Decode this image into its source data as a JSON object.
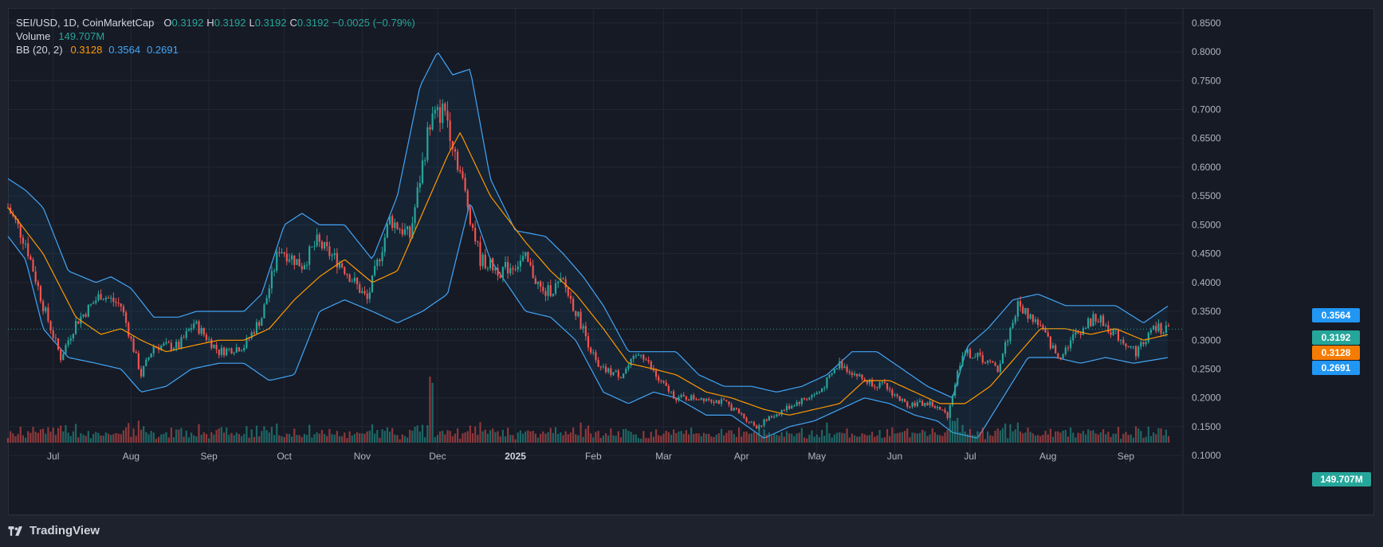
{
  "legend": {
    "symbol": "SEI/USD, 1D, CoinMarketCap",
    "o_label": "O",
    "o_value": "0.3192",
    "h_label": "H",
    "h_value": "0.3192",
    "l_label": "L",
    "l_value": "0.3192",
    "c_label": "C",
    "c_value": "0.3192",
    "change": "−0.0025 (−0.79%)",
    "volume_label": "Volume",
    "volume_value": "149.707M",
    "bb_label": "BB (20, 2)",
    "bb_basis": "0.3128",
    "bb_upper": "0.3564",
    "bb_lower": "0.2691"
  },
  "price_tags": {
    "upper": "0.3564",
    "last": "0.3192",
    "basis": "0.3128",
    "lower": "0.2691",
    "volume": "149.707M"
  },
  "brand": "TradingView",
  "colors": {
    "up": "#26a69a",
    "down": "#ef5350",
    "band": "#42a5f5",
    "basis": "#ff9800",
    "bg": "#161a25",
    "grid": "#232734",
    "text": "#b2b5be"
  },
  "chart_data": {
    "type": "candlestick",
    "title": "SEI/USD, 1D, CoinMarketCap",
    "x_ticks": [
      "Jul",
      "Aug",
      "Sep",
      "Oct",
      "Nov",
      "Dec",
      "2025",
      "Feb",
      "Mar",
      "Apr",
      "May",
      "Jun",
      "Jul",
      "Aug",
      "Sep"
    ],
    "y_ticks": [
      "0.8500",
      "0.8000",
      "0.7500",
      "0.7000",
      "0.6500",
      "0.6000",
      "0.5500",
      "0.5000",
      "0.4500",
      "0.4000",
      "0.3500",
      "0.3000",
      "0.2500",
      "0.2000",
      "0.1500",
      "0.1000"
    ],
    "ylim": [
      0.085,
      0.876
    ],
    "grid": true,
    "close_path": [
      [
        "2024-06-13",
        0.53
      ],
      [
        "2024-06-20",
        0.47
      ],
      [
        "2024-06-27",
        0.36
      ],
      [
        "2024-07-04",
        0.27
      ],
      [
        "2024-07-10",
        0.33
      ],
      [
        "2024-07-20",
        0.38
      ],
      [
        "2024-07-28",
        0.36
      ],
      [
        "2024-08-05",
        0.24
      ],
      [
        "2024-08-10",
        0.29
      ],
      [
        "2024-08-20",
        0.29
      ],
      [
        "2024-08-26",
        0.33
      ],
      [
        "2024-09-05",
        0.28
      ],
      [
        "2024-09-15",
        0.29
      ],
      [
        "2024-09-22",
        0.34
      ],
      [
        "2024-09-29",
        0.46
      ],
      [
        "2024-10-08",
        0.43
      ],
      [
        "2024-10-14",
        0.47
      ],
      [
        "2024-10-24",
        0.43
      ],
      [
        "2024-11-03",
        0.37
      ],
      [
        "2024-11-12",
        0.51
      ],
      [
        "2024-11-20",
        0.48
      ],
      [
        "2024-11-28",
        0.68
      ],
      [
        "2024-12-04",
        0.7
      ],
      [
        "2024-12-09",
        0.61
      ],
      [
        "2024-12-18",
        0.44
      ],
      [
        "2024-12-26",
        0.42
      ],
      [
        "2025-01-05",
        0.44
      ],
      [
        "2025-01-12",
        0.38
      ],
      [
        "2025-01-20",
        0.4
      ],
      [
        "2025-01-27",
        0.33
      ],
      [
        "2025-02-03",
        0.25
      ],
      [
        "2025-02-12",
        0.24
      ],
      [
        "2025-02-20",
        0.28
      ],
      [
        "2025-02-27",
        0.23
      ],
      [
        "2025-03-06",
        0.2
      ],
      [
        "2025-03-18",
        0.2
      ],
      [
        "2025-03-26",
        0.19
      ],
      [
        "2025-04-07",
        0.15
      ],
      [
        "2025-04-14",
        0.17
      ],
      [
        "2025-04-22",
        0.19
      ],
      [
        "2025-05-02",
        0.21
      ],
      [
        "2025-05-10",
        0.26
      ],
      [
        "2025-05-20",
        0.23
      ],
      [
        "2025-05-28",
        0.22
      ],
      [
        "2025-06-05",
        0.19
      ],
      [
        "2025-06-15",
        0.19
      ],
      [
        "2025-06-22",
        0.17
      ],
      [
        "2025-06-28",
        0.28
      ],
      [
        "2025-07-05",
        0.27
      ],
      [
        "2025-07-12",
        0.25
      ],
      [
        "2025-07-20",
        0.36
      ],
      [
        "2025-07-28",
        0.33
      ],
      [
        "2025-08-05",
        0.27
      ],
      [
        "2025-08-12",
        0.31
      ],
      [
        "2025-08-20",
        0.34
      ],
      [
        "2025-08-28",
        0.31
      ],
      [
        "2025-09-05",
        0.28
      ],
      [
        "2025-09-12",
        0.32
      ],
      [
        "2025-09-18",
        0.32
      ]
    ],
    "bollinger": {
      "upper": [
        [
          "2024-06-13",
          0.58
        ],
        [
          "2024-06-20",
          0.56
        ],
        [
          "2024-06-27",
          0.53
        ],
        [
          "2024-07-07",
          0.42
        ],
        [
          "2024-07-18",
          0.4
        ],
        [
          "2024-07-24",
          0.41
        ],
        [
          "2024-08-01",
          0.39
        ],
        [
          "2024-08-10",
          0.34
        ],
        [
          "2024-08-20",
          0.34
        ],
        [
          "2024-08-27",
          0.35
        ],
        [
          "2024-09-05",
          0.35
        ],
        [
          "2024-09-15",
          0.35
        ],
        [
          "2024-09-22",
          0.38
        ],
        [
          "2024-10-01",
          0.5
        ],
        [
          "2024-10-08",
          0.52
        ],
        [
          "2024-10-15",
          0.5
        ],
        [
          "2024-10-25",
          0.5
        ],
        [
          "2024-11-05",
          0.44
        ],
        [
          "2024-11-15",
          0.55
        ],
        [
          "2024-11-24",
          0.74
        ],
        [
          "2024-12-01",
          0.8
        ],
        [
          "2024-12-07",
          0.76
        ],
        [
          "2024-12-14",
          0.77
        ],
        [
          "2024-12-22",
          0.58
        ],
        [
          "2025-01-01",
          0.49
        ],
        [
          "2025-01-13",
          0.48
        ],
        [
          "2025-01-20",
          0.45
        ],
        [
          "2025-01-28",
          0.41
        ],
        [
          "2025-02-05",
          0.36
        ],
        [
          "2025-02-15",
          0.28
        ],
        [
          "2025-02-25",
          0.28
        ],
        [
          "2025-03-06",
          0.28
        ],
        [
          "2025-03-15",
          0.24
        ],
        [
          "2025-03-25",
          0.22
        ],
        [
          "2025-04-05",
          0.22
        ],
        [
          "2025-04-15",
          0.21
        ],
        [
          "2025-04-25",
          0.22
        ],
        [
          "2025-05-05",
          0.24
        ],
        [
          "2025-05-15",
          0.28
        ],
        [
          "2025-05-25",
          0.28
        ],
        [
          "2025-06-04",
          0.25
        ],
        [
          "2025-06-14",
          0.22
        ],
        [
          "2025-06-24",
          0.2
        ],
        [
          "2025-06-30",
          0.29
        ],
        [
          "2025-07-08",
          0.32
        ],
        [
          "2025-07-18",
          0.37
        ],
        [
          "2025-07-28",
          0.38
        ],
        [
          "2025-08-08",
          0.36
        ],
        [
          "2025-08-18",
          0.36
        ],
        [
          "2025-08-28",
          0.36
        ],
        [
          "2025-09-08",
          0.33
        ],
        [
          "2025-09-18",
          0.36
        ]
      ],
      "lower": [
        [
          "2024-06-13",
          0.48
        ],
        [
          "2024-06-20",
          0.44
        ],
        [
          "2024-06-27",
          0.32
        ],
        [
          "2024-07-07",
          0.27
        ],
        [
          "2024-07-18",
          0.26
        ],
        [
          "2024-07-28",
          0.25
        ],
        [
          "2024-08-05",
          0.21
        ],
        [
          "2024-08-15",
          0.22
        ],
        [
          "2024-08-25",
          0.25
        ],
        [
          "2024-09-05",
          0.26
        ],
        [
          "2024-09-15",
          0.26
        ],
        [
          "2024-09-25",
          0.23
        ],
        [
          "2024-10-05",
          0.24
        ],
        [
          "2024-10-15",
          0.35
        ],
        [
          "2024-10-25",
          0.37
        ],
        [
          "2024-11-05",
          0.35
        ],
        [
          "2024-11-15",
          0.33
        ],
        [
          "2024-11-25",
          0.35
        ],
        [
          "2024-12-05",
          0.38
        ],
        [
          "2024-12-14",
          0.54
        ],
        [
          "2024-12-22",
          0.44
        ],
        [
          "2025-01-05",
          0.35
        ],
        [
          "2025-01-15",
          0.34
        ],
        [
          "2025-01-25",
          0.3
        ],
        [
          "2025-02-05",
          0.21
        ],
        [
          "2025-02-15",
          0.19
        ],
        [
          "2025-02-25",
          0.21
        ],
        [
          "2025-03-06",
          0.2
        ],
        [
          "2025-03-18",
          0.17
        ],
        [
          "2025-03-28",
          0.17
        ],
        [
          "2025-04-10",
          0.13
        ],
        [
          "2025-04-20",
          0.15
        ],
        [
          "2025-04-30",
          0.16
        ],
        [
          "2025-05-10",
          0.18
        ],
        [
          "2025-05-20",
          0.2
        ],
        [
          "2025-05-30",
          0.19
        ],
        [
          "2025-06-09",
          0.17
        ],
        [
          "2025-06-18",
          0.16
        ],
        [
          "2025-06-24",
          0.14
        ],
        [
          "2025-07-04",
          0.13
        ],
        [
          "2025-07-14",
          0.2
        ],
        [
          "2025-07-24",
          0.27
        ],
        [
          "2025-08-04",
          0.27
        ],
        [
          "2025-08-14",
          0.26
        ],
        [
          "2025-08-24",
          0.27
        ],
        [
          "2025-09-04",
          0.26
        ],
        [
          "2025-09-18",
          0.27
        ]
      ],
      "basis": [
        [
          "2024-06-13",
          0.53
        ],
        [
          "2024-06-27",
          0.45
        ],
        [
          "2024-07-10",
          0.34
        ],
        [
          "2024-07-20",
          0.31
        ],
        [
          "2024-07-28",
          0.32
        ],
        [
          "2024-08-05",
          0.3
        ],
        [
          "2024-08-15",
          0.28
        ],
        [
          "2024-08-25",
          0.29
        ],
        [
          "2024-09-05",
          0.3
        ],
        [
          "2024-09-15",
          0.3
        ],
        [
          "2024-09-25",
          0.32
        ],
        [
          "2024-10-05",
          0.37
        ],
        [
          "2024-10-15",
          0.41
        ],
        [
          "2024-10-25",
          0.44
        ],
        [
          "2024-11-05",
          0.4
        ],
        [
          "2024-11-15",
          0.42
        ],
        [
          "2024-11-25",
          0.52
        ],
        [
          "2024-12-05",
          0.62
        ],
        [
          "2024-12-10",
          0.66
        ],
        [
          "2024-12-22",
          0.55
        ],
        [
          "2025-01-05",
          0.47
        ],
        [
          "2025-01-15",
          0.42
        ],
        [
          "2025-01-25",
          0.38
        ],
        [
          "2025-02-05",
          0.32
        ],
        [
          "2025-02-15",
          0.26
        ],
        [
          "2025-02-25",
          0.25
        ],
        [
          "2025-03-06",
          0.24
        ],
        [
          "2025-03-18",
          0.21
        ],
        [
          "2025-03-28",
          0.2
        ],
        [
          "2025-04-10",
          0.18
        ],
        [
          "2025-04-20",
          0.17
        ],
        [
          "2025-04-30",
          0.18
        ],
        [
          "2025-05-10",
          0.19
        ],
        [
          "2025-05-20",
          0.23
        ],
        [
          "2025-05-30",
          0.23
        ],
        [
          "2025-06-09",
          0.21
        ],
        [
          "2025-06-19",
          0.19
        ],
        [
          "2025-06-29",
          0.19
        ],
        [
          "2025-07-09",
          0.22
        ],
        [
          "2025-07-19",
          0.27
        ],
        [
          "2025-07-29",
          0.32
        ],
        [
          "2025-08-08",
          0.32
        ],
        [
          "2025-08-18",
          0.31
        ],
        [
          "2025-08-28",
          0.32
        ],
        [
          "2025-09-08",
          0.3
        ],
        [
          "2025-09-18",
          0.31
        ]
      ]
    },
    "last_price": 0.3192,
    "volume_last": "149.707M"
  }
}
